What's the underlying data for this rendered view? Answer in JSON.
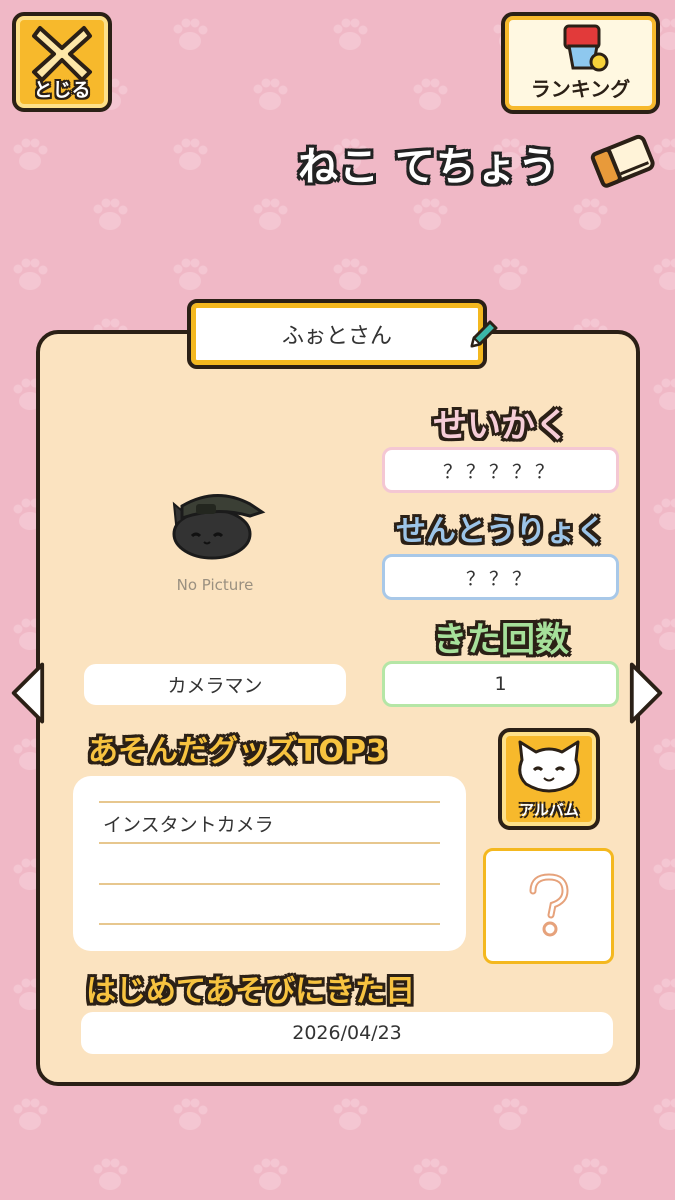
{
  "header": {
    "close_label": "とじる",
    "ranking_label": "ランキング",
    "title": "ねこ てちょう"
  },
  "cat": {
    "name": "ふぉとさん",
    "no_picture": "No Picture",
    "goods_required": "カメラマン"
  },
  "stats": {
    "personality_label": "せいかく",
    "personality_value": "？？？？？",
    "power_label": "せんとうりょく",
    "power_value": "？？？",
    "visits_label": "きた回数",
    "visits_value": "1"
  },
  "goods": {
    "label": "あそんだグッズTOP3",
    "items": [
      "インスタントカメラ",
      "",
      ""
    ]
  },
  "album": {
    "label": "アルバム"
  },
  "first_visit": {
    "label": "はじめてあそびにきた日",
    "date": "2026/04/23"
  },
  "colors": {
    "background": "#f0b8c6",
    "panel": "#fbe3c0",
    "accent_yellow": "#f7b92c",
    "pink_field": "#f4c7d3",
    "blue_field": "#a8c8e8",
    "green_field": "#b5e6a6"
  },
  "icons": {
    "close": "close-x-icon",
    "ranking": "trophy-cup-icon",
    "notebook": "notebook-icon",
    "edit": "pencil-icon",
    "album": "cat-face-icon",
    "mystery": "question-mark-icon",
    "prev": "chevron-left-icon",
    "next": "chevron-right-icon"
  }
}
